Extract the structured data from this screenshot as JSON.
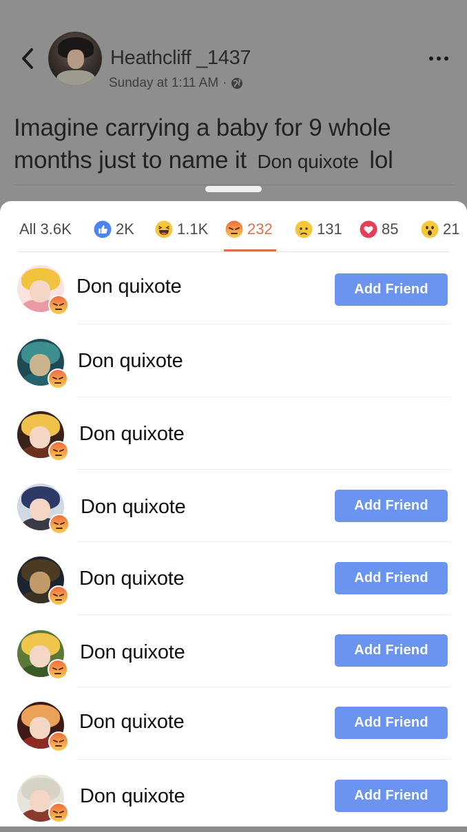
{
  "post": {
    "poster_name": "Heathcliff _1437",
    "timestamp": "Sunday at 1:11 AM",
    "separator": "·",
    "text_part1": "Imagine carrying a baby for 9 whole months just to name it",
    "mention": "Don quixote",
    "text_part2": "lol"
  },
  "tabs": [
    {
      "label": "All 3.6K",
      "icon": "none"
    },
    {
      "label": "2K",
      "icon": "like-icon"
    },
    {
      "label": "1.1K",
      "icon": "haha-icon"
    },
    {
      "label": "232",
      "icon": "angry-icon",
      "active": true
    },
    {
      "label": "131",
      "icon": "sad-icon"
    },
    {
      "label": "85",
      "icon": "love-icon"
    },
    {
      "label": "21",
      "icon": "wow-icon"
    }
  ],
  "reactors": [
    {
      "name": "Don quixote",
      "button": "Add Friend",
      "reaction": "angry-icon"
    },
    {
      "name": "Don quixote",
      "button": "",
      "reaction": "angry-icon"
    },
    {
      "name": "Don quixote",
      "button": "",
      "reaction": "angry-icon"
    },
    {
      "name": "Don quixote",
      "button": "Add Friend",
      "reaction": "angry-icon"
    },
    {
      "name": "Don quixote",
      "button": "Add Friend",
      "reaction": "angry-icon"
    },
    {
      "name": "Don quixote",
      "button": "Add Friend",
      "reaction": "angry-icon"
    },
    {
      "name": "Don quixote",
      "button": "Add Friend",
      "reaction": "angry-icon"
    },
    {
      "name": "Don quixote",
      "button": "Add Friend",
      "reaction": "angry-icon"
    }
  ],
  "colors": {
    "accent_angry": "#d9704f",
    "button_blue": "#6a94f0",
    "like_blue": "#4b85f0",
    "love_red": "#e4405a"
  }
}
